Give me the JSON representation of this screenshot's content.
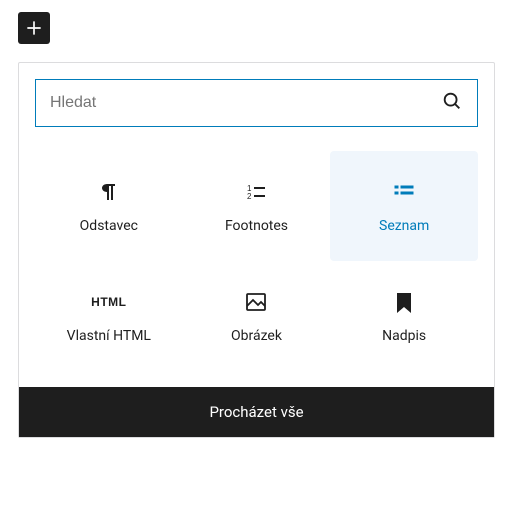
{
  "toggle": {
    "name": "add-block"
  },
  "search": {
    "placeholder": "Hledat"
  },
  "blocks": [
    {
      "label": "Odstavec",
      "icon": "paragraph-icon",
      "selected": false
    },
    {
      "label": "Footnotes",
      "icon": "footnotes-icon",
      "selected": false
    },
    {
      "label": "Seznam",
      "icon": "list-icon",
      "selected": true
    },
    {
      "label": "Vlastní HTML",
      "icon": "html-icon",
      "selected": false
    },
    {
      "label": "Obrázek",
      "icon": "image-icon",
      "selected": false
    },
    {
      "label": "Nadpis",
      "icon": "heading-icon",
      "selected": false
    }
  ],
  "footer": {
    "browse_all": "Procházet vše"
  }
}
